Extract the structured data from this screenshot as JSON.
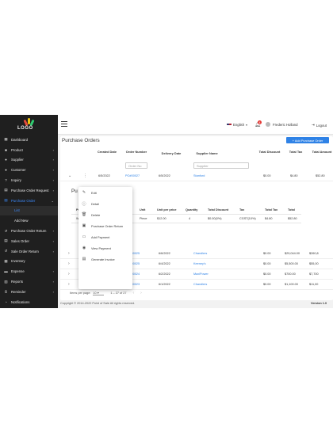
{
  "sidebar": {
    "logo_text": "LOGO",
    "items": [
      {
        "label": "Dashboard",
        "icon": "dashboard-icon",
        "chevron": false
      },
      {
        "label": "Product",
        "icon": "product-icon",
        "chevron": true
      },
      {
        "label": "Supplier",
        "icon": "supplier-icon",
        "chevron": true
      },
      {
        "label": "Customer",
        "icon": "customer-icon",
        "chevron": true
      },
      {
        "label": "Inquiry",
        "icon": "inquiry-icon",
        "chevron": true
      },
      {
        "label": "Purchase Order Request",
        "icon": "request-icon",
        "chevron": true
      },
      {
        "label": "Purchase Order",
        "icon": "purchase-order-icon",
        "chevron": true
      },
      {
        "label": "List",
        "sub": true
      },
      {
        "label": "Add New",
        "sub": true
      },
      {
        "label": "Purchase Order Return",
        "icon": "return-icon",
        "chevron": true
      },
      {
        "label": "Sales Order",
        "icon": "sales-order-icon",
        "chevron": true
      },
      {
        "label": "Sale Order Return",
        "icon": "sale-return-icon",
        "chevron": true
      },
      {
        "label": "Inventory",
        "icon": "inventory-icon",
        "chevron": false
      },
      {
        "label": "Expense",
        "icon": "expense-icon",
        "chevron": true
      },
      {
        "label": "Reports",
        "icon": "reports-icon",
        "chevron": true
      },
      {
        "label": "Reminder",
        "icon": "reminder-icon",
        "chevron": true
      },
      {
        "label": "Notifications",
        "icon": "notifications-icon",
        "chevron": false
      }
    ]
  },
  "topbar": {
    "language": "English",
    "notification_count": "4",
    "user_name": "Frederic Holland",
    "logout_label": "Logout"
  },
  "page": {
    "title": "Purchase Orders",
    "add_button": "+ Add Purchase Order"
  },
  "table": {
    "headers": {
      "created": "Created Date",
      "order": "Order Number",
      "delivery": "Delivery Date",
      "supplier": "Supplier Name",
      "discount": "Total Discount",
      "tax": "Total Tax",
      "amount": "Total Amount"
    },
    "filters": {
      "order_placeholder": "Order No",
      "supplier_placeholder": "Supplier"
    },
    "first_row": {
      "created": "6/5/2022",
      "order": "PO#00027",
      "delivery": "6/5/2022",
      "supplier": "Stanford",
      "discount": "$0.00",
      "tax": "$4.80",
      "amount": "$52.80"
    },
    "rows": [
      {
        "order": "PO#00025",
        "delivery": "6/6/2022",
        "supplier": "Chandlers",
        "discount": "$0.00",
        "tax": "$29,044.00",
        "amount": "$260,8"
      },
      {
        "order": "PO#00025",
        "delivery": "6/4/2022",
        "supplier": "Keeney's",
        "discount": "$0.00",
        "tax": "$5,500.00",
        "amount": "$55,00"
      },
      {
        "order": "PO#00024",
        "delivery": "6/2/2022",
        "supplier": "MaxiPower",
        "discount": "$0.00",
        "tax": "$700.00",
        "amount": "$7,700"
      },
      {
        "order": "PO#00023",
        "delivery": "6/1/2022",
        "supplier": "Chandlers",
        "discount": "$0.00",
        "tax": "$1,100.00",
        "amount": "$11,00"
      }
    ]
  },
  "detail": {
    "title": "Pu",
    "headers": {
      "product": "Pro",
      "unit": "Unit",
      "unit_price": "Unit per price",
      "quantity": "Quantity",
      "total_discount": "Total Discount",
      "tax": "Tax",
      "total_tax": "Total Tax",
      "total": "Total"
    },
    "row": {
      "product": "Wi",
      "unit": "Piece",
      "unit_price": "$12.00",
      "quantity": "4",
      "total_discount": "$0.00(0%)",
      "tax": "CGST(10%)",
      "total_tax": "$4.80",
      "total": "$52.80"
    }
  },
  "menu": [
    {
      "label": "Edit",
      "icon": "edit-icon"
    },
    {
      "label": "Detail",
      "icon": "info-icon"
    },
    {
      "label": "Delete",
      "icon": "delete-icon"
    },
    {
      "label": "Purchase Order Return",
      "icon": "return-icon"
    },
    {
      "label": "Add Payment",
      "icon": "add-payment-icon"
    },
    {
      "label": "View Payment",
      "icon": "view-icon"
    },
    {
      "label": "Generate Invoice",
      "icon": "invoice-icon"
    }
  ],
  "paginator": {
    "label": "Items per page:",
    "size": "10",
    "range": "1 – 27 of 27"
  },
  "footer": {
    "copyright": "Copyright © 2014-2022 Point of Sale All rights reserved.",
    "version": "Version 1.0"
  },
  "colors": {
    "accent": "#2f82e6",
    "sidebar": "#1f1f1f"
  }
}
